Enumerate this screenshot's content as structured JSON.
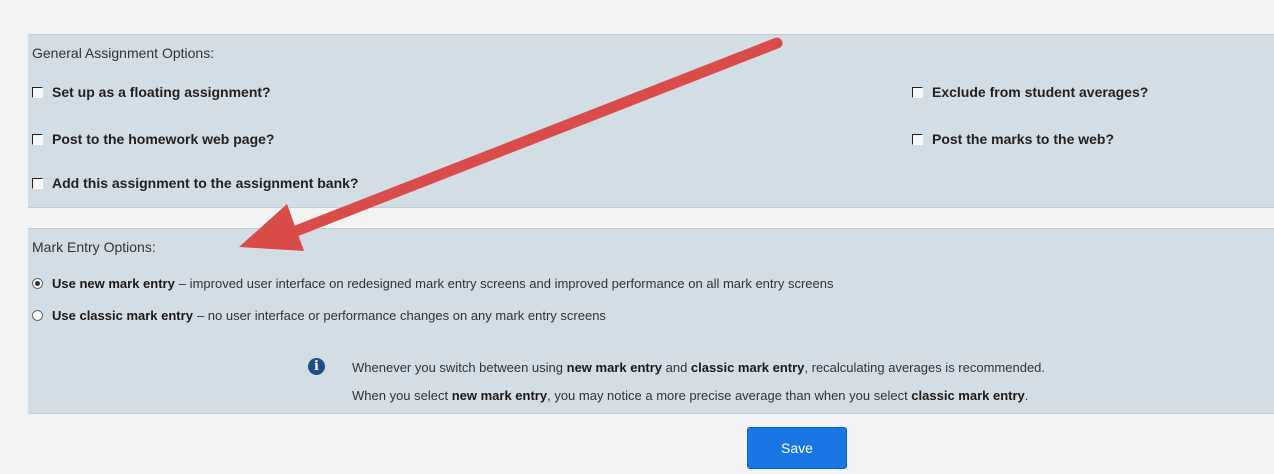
{
  "general_options": {
    "title": "General Assignment Options:",
    "options": [
      {
        "label": "Set up as a floating assignment?",
        "checked": false
      },
      {
        "label": "Post to the homework web page?",
        "checked": false
      },
      {
        "label": "Add this assignment to the assignment bank?",
        "checked": false
      },
      {
        "label": "Exclude from student averages?",
        "checked": false
      },
      {
        "label": "Post the marks to the web?",
        "checked": false
      }
    ]
  },
  "mark_entry": {
    "title": "Mark Entry Options:",
    "options": [
      {
        "label": "Use new mark entry",
        "description": "– improved user interface on redesigned mark entry screens and improved performance on all mark entry screens",
        "selected": true
      },
      {
        "label": "Use classic mark entry",
        "description": "– no user interface or performance changes on any mark entry screens",
        "selected": false
      }
    ],
    "info": {
      "icon": "info-icon",
      "line1": {
        "part1": "Whenever you switch between using ",
        "b1": "new mark entry",
        "part2": " and ",
        "b2": "classic mark entry",
        "part3": ", recalculating averages is recommended."
      },
      "line2": {
        "part1": "When you select ",
        "b1": "new mark entry",
        "part2": ", you may notice a more precise average than when you select ",
        "b2": "classic mark entry",
        "part3": "."
      }
    }
  },
  "save_label": "Save",
  "colors": {
    "panel": "#d3dde6",
    "arrow": "#d94c4a",
    "save_button": "#1976e5",
    "info_icon": "#1d4f86"
  }
}
